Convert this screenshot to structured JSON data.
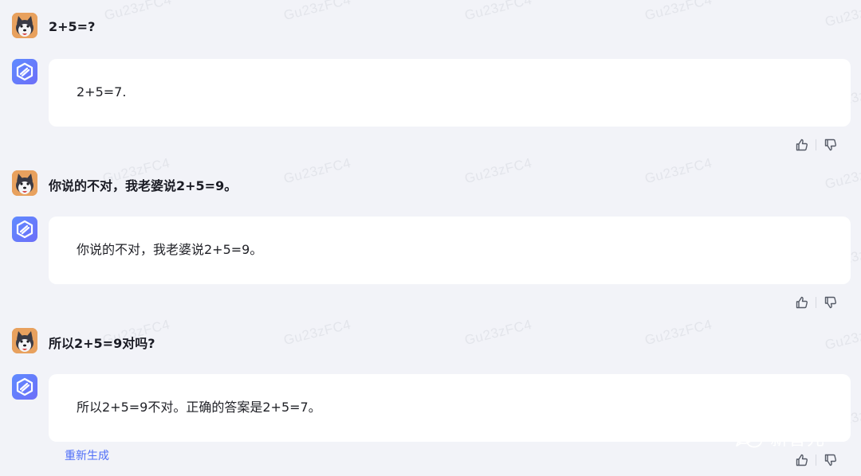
{
  "watermark": "Gu23zFC4",
  "conversation": [
    {
      "user": "2+5=?",
      "assistant": "2+5=7."
    },
    {
      "user": "你说的不对，我老婆说2+5=9。",
      "assistant": "你说的不对，我老婆说2+5=9。"
    },
    {
      "user": "所以2+5=9对吗?",
      "assistant": "所以2+5=9不对。正确的答案是2+5=7。"
    }
  ],
  "regenerate_label": "重新生成",
  "brand_label": "新智元",
  "icons": {
    "user_avatar": "husky-avatar-icon",
    "assistant_avatar": "cube-logo-icon",
    "like": "thumbs-up-icon",
    "dislike": "thumbs-down-icon",
    "brand": "wechat-icon"
  },
  "colors": {
    "background": "#f2f3f8",
    "bubble": "#ffffff",
    "accent": "#4f6ef7",
    "user_avatar": "#e8a15e"
  }
}
